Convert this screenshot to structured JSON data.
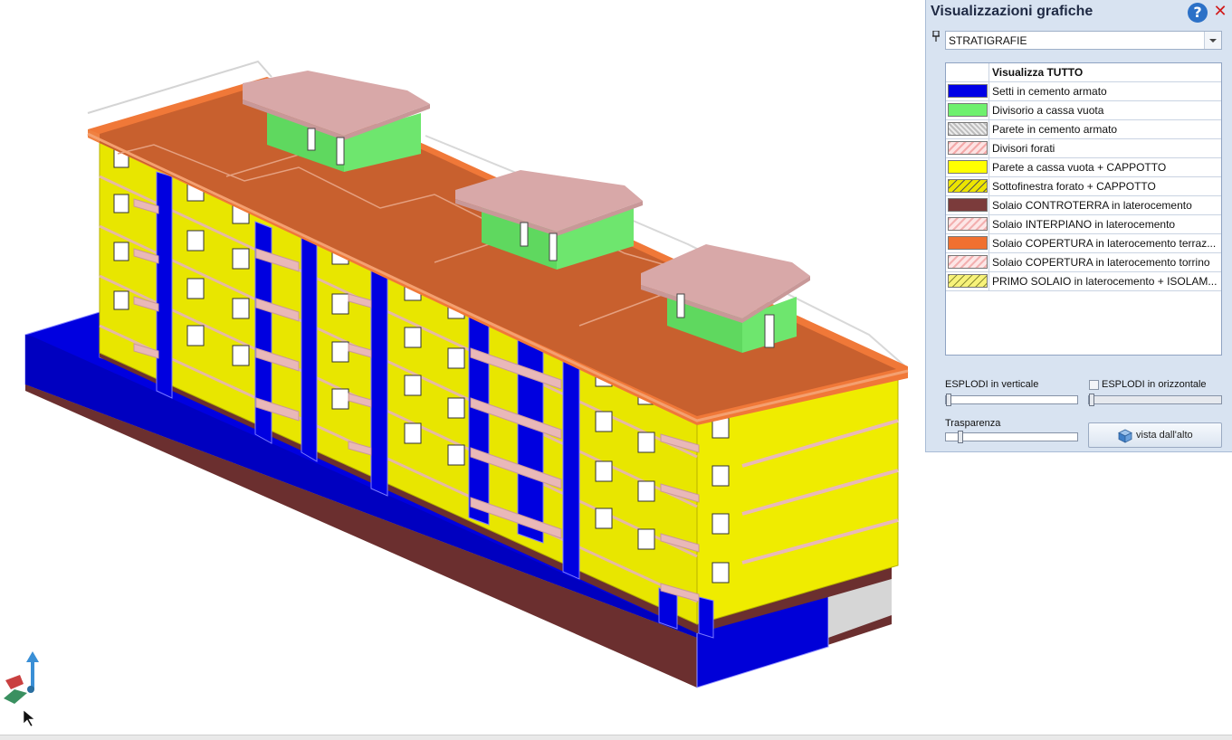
{
  "panel": {
    "title": "Visualizzazioni grafiche",
    "help_icon": "?",
    "close_icon": "✕",
    "dropdown_value": "STRATIGRAFIE",
    "legend_header": "Visualizza TUTTO",
    "legend": [
      {
        "label": "Setti in cemento armato",
        "color": "#0000e6",
        "pattern": "solid"
      },
      {
        "label": "Divisorio a cassa vuota",
        "color": "#6ef06e",
        "pattern": "solid"
      },
      {
        "label": "Parete in cemento armato",
        "color": "#c8c8c8",
        "pattern": "crosshatch"
      },
      {
        "label": "Divisori forati",
        "color": "#f6c7c7",
        "pattern": "hatch-red"
      },
      {
        "label": "Parete a cassa vuota + CAPPOTTO",
        "color": "#ffff00",
        "pattern": "solid"
      },
      {
        "label": "Sottofinestra forato + CAPPOTTO",
        "color": "#e8e000",
        "pattern": "hatch-dark"
      },
      {
        "label": "Solaio CONTROTERRA in laterocemento",
        "color": "#7b3b3b",
        "pattern": "solid"
      },
      {
        "label": "Solaio INTERPIANO  in laterocemento",
        "color": "#f9d5d5",
        "pattern": "hatch-red"
      },
      {
        "label": "Solaio COPERTURA  in laterocemento terraz...",
        "color": "#f07030",
        "pattern": "solid"
      },
      {
        "label": "Solaio COPERTURA  in laterocemento torrino",
        "color": "#f9d5d5",
        "pattern": "hatch-red"
      },
      {
        "label": "PRIMO SOLAIO in laterocemento + ISOLAM...",
        "color": "#f5ef6e",
        "pattern": "hatch-dark"
      }
    ],
    "explode_vertical_label": "ESPLODI in verticale",
    "explode_horizontal_label": "ESPLODI in orizzontale",
    "explode_horizontal_checked": false,
    "transparency_label": "Trasparenza",
    "top_view_button": "vista dall'alto"
  }
}
